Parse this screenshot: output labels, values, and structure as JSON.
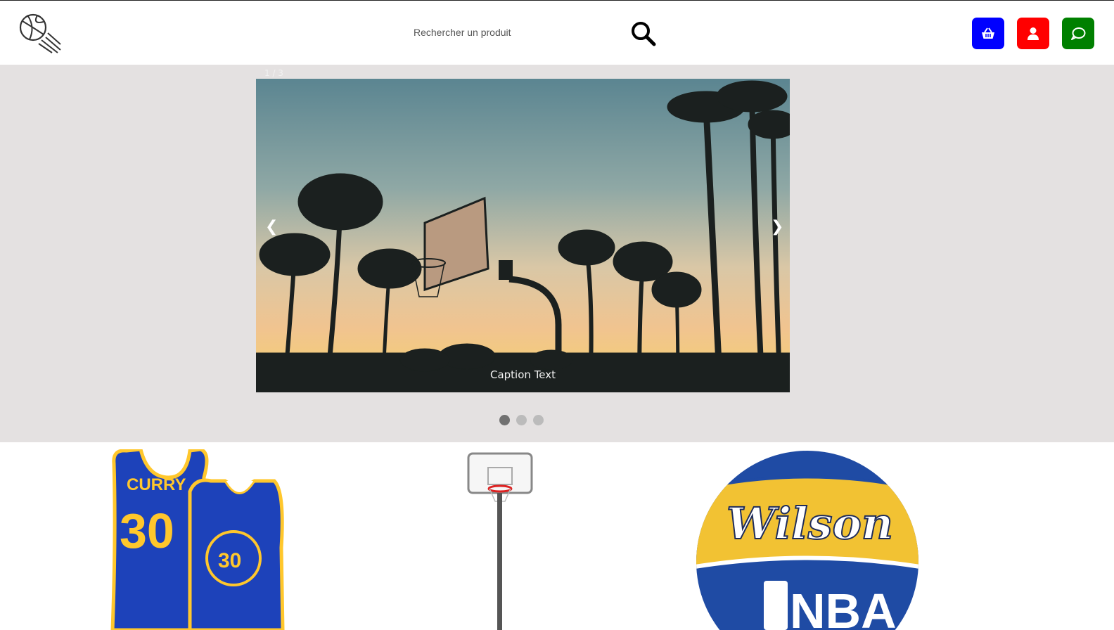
{
  "header": {
    "logo_icon": "basketball-motion-icon",
    "search": {
      "placeholder": "Rechercher un produit",
      "value": ""
    },
    "buttons": [
      {
        "name": "cart-button",
        "icon": "basket-icon",
        "color": "#0000ff"
      },
      {
        "name": "account-button",
        "icon": "user-icon",
        "color": "#ff0000"
      },
      {
        "name": "chat-button",
        "icon": "chat-bubble-icon",
        "color": "#008000"
      }
    ]
  },
  "slideshow": {
    "number_text": "1 / 3",
    "caption": "Caption Text",
    "prev_label": "❮",
    "next_label": "❯",
    "dots": [
      true,
      false,
      false
    ],
    "background": "#e4e1e1"
  },
  "products": [
    {
      "name": "Curry 30 Golden State Warriors jersey"
    },
    {
      "name": "basketball hoop stand"
    },
    {
      "name": "Wilson NBA basketball"
    }
  ],
  "colors": {
    "cart": "#0000ff",
    "account": "#ff0000",
    "chat": "#008000",
    "dot_active": "#717171",
    "dot": "#bbbbbb"
  }
}
